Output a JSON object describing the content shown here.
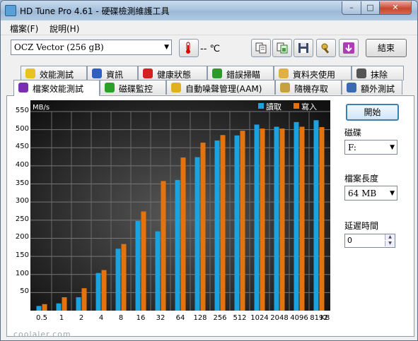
{
  "window": {
    "title": "HD Tune Pro 4.61 - 硬碟檢測維護工具"
  },
  "menu": {
    "file": "檔案(F)",
    "help": "說明(H)"
  },
  "toolbar": {
    "drive": "OCZ Vector (256 gB)",
    "temperature": "-- ℃",
    "exit": "結束"
  },
  "tabs_row1": [
    "效能測試",
    "資訊",
    "健康狀態",
    "錯誤掃瞄",
    "資料夾使用",
    "抹除"
  ],
  "tabs_row2": [
    "檔案效能測試",
    "磁碟監控",
    "自動噪聲管理(AAM)",
    "隨機存取",
    "額外測試"
  ],
  "side": {
    "start": "開始",
    "disk_label": "磁碟",
    "disk_value": "F:",
    "file_length_label": "檔案長度",
    "file_length_value": "64 MB",
    "delay_label": "延遲時間",
    "delay_value": "0"
  },
  "chart_data": {
    "type": "bar",
    "ylabel": "MB/s",
    "xunit": "KB",
    "ylim": [
      0,
      550
    ],
    "yticks": [
      50,
      100,
      150,
      200,
      250,
      300,
      350,
      400,
      450,
      500,
      550
    ],
    "categories": [
      "0.5",
      "1",
      "2",
      "4",
      "8",
      "16",
      "32",
      "64",
      "128",
      "256",
      "512",
      "1024",
      "2048",
      "4096",
      "8192"
    ],
    "series": [
      {
        "name": "讀取",
        "color": "#1aa3e0",
        "values": [
          13,
          20,
          37,
          104,
          171,
          248,
          219,
          361,
          424,
          470,
          484,
          514,
          508,
          521,
          526
        ]
      },
      {
        "name": "寫入",
        "color": "#e6720e",
        "values": [
          18,
          37,
          62,
          112,
          184,
          274,
          358,
          423,
          464,
          485,
          497,
          503,
          503,
          508,
          507
        ]
      }
    ],
    "grid": true,
    "legend": "top-right"
  },
  "watermark": "coolaler.com"
}
